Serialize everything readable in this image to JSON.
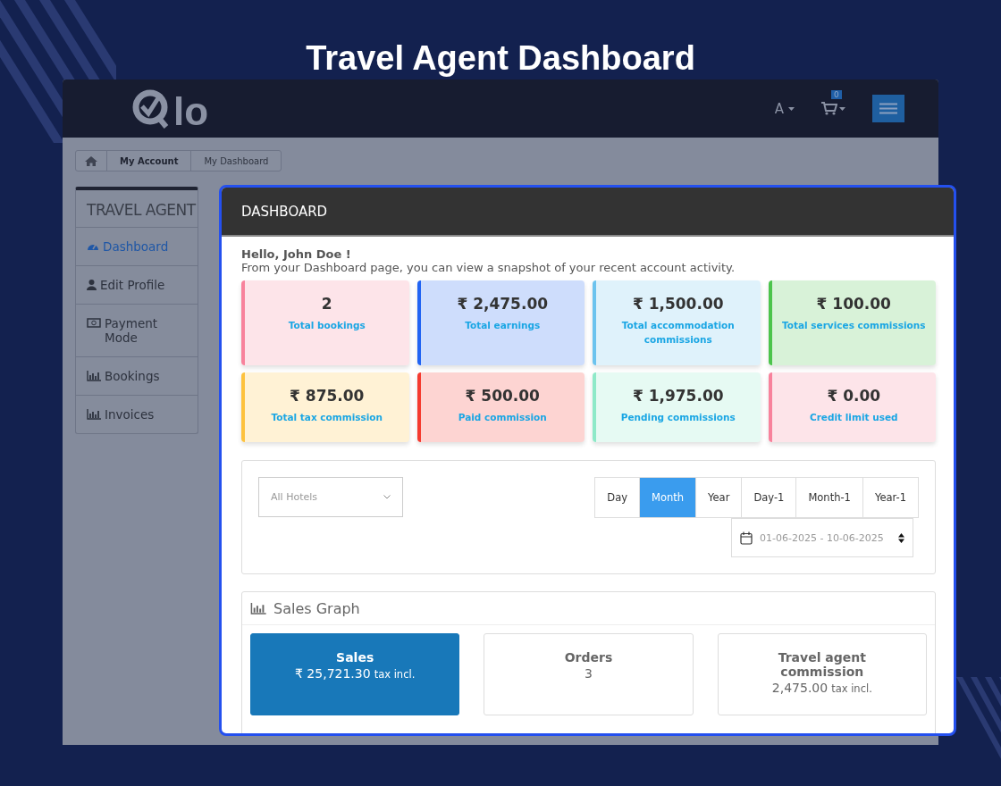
{
  "page_title": "Travel Agent Dashboard",
  "header": {
    "logo_text": "lo",
    "language": "A",
    "cart_count": "0"
  },
  "breadcrumb": [
    "My Account",
    "My Dashboard"
  ],
  "sidebar": {
    "heading": "TRAVEL AGENT",
    "items": [
      {
        "label": "Dashboard",
        "kind": "gauge",
        "selected": true
      },
      {
        "label": "Edit Profile",
        "kind": "user",
        "selected": false
      },
      {
        "label": "Payment Mode",
        "kind": "money",
        "selected": false
      },
      {
        "label": "Bookings",
        "kind": "chart",
        "selected": false
      },
      {
        "label": "Invoices",
        "kind": "chart",
        "selected": false
      }
    ]
  },
  "dashboard": {
    "title": "DASHBOARD",
    "greeting": "Hello, John Doe !",
    "intro": "From your Dashboard page, you can view a snapshot of your recent account activity.",
    "stats": [
      {
        "value": "2",
        "label": "Total bookings",
        "color": "#f8829c"
      },
      {
        "value": "₹ 2,475.00",
        "label": "Total earnings",
        "color": "#2164f3"
      },
      {
        "value": "₹ 1,500.00",
        "label": "Total accommodation commissions",
        "color": "#6cc3ee"
      },
      {
        "value": "₹ 100.00",
        "label": "Total services commissions",
        "color": "#4cc44c"
      },
      {
        "value": "₹ 875.00",
        "label": "Total tax commission",
        "color": "#fdc23e"
      },
      {
        "value": "₹ 500.00",
        "label": "Paid commission",
        "color": "#f53b30"
      },
      {
        "value": "₹ 1,975.00",
        "label": "Pending commissions",
        "color": "#8ee9c8"
      },
      {
        "value": "₹ 0.00",
        "label": "Credit limit used",
        "color": "#f8829c"
      }
    ],
    "hotel_select": {
      "placeholder": "All Hotels"
    },
    "ranges": [
      {
        "label": "Day",
        "selected": false
      },
      {
        "label": "Month",
        "selected": true
      },
      {
        "label": "Year",
        "selected": false
      },
      {
        "label": "Day-1",
        "selected": false
      },
      {
        "label": "Month-1",
        "selected": false
      },
      {
        "label": "Year-1",
        "selected": false
      }
    ],
    "date_range": "01-06-2025 - 10-06-2025",
    "sales_graph": {
      "title": "Sales Graph",
      "cards": [
        {
          "title": "Sales",
          "value": "₹ 25,721.30",
          "suffix": "tax incl.",
          "selected": true
        },
        {
          "title": "Orders",
          "value": "3",
          "selected": false
        },
        {
          "title": "Travel agent commission",
          "value": "2,475.00",
          "suffix": "tax incl.",
          "selected": false
        }
      ]
    }
  }
}
